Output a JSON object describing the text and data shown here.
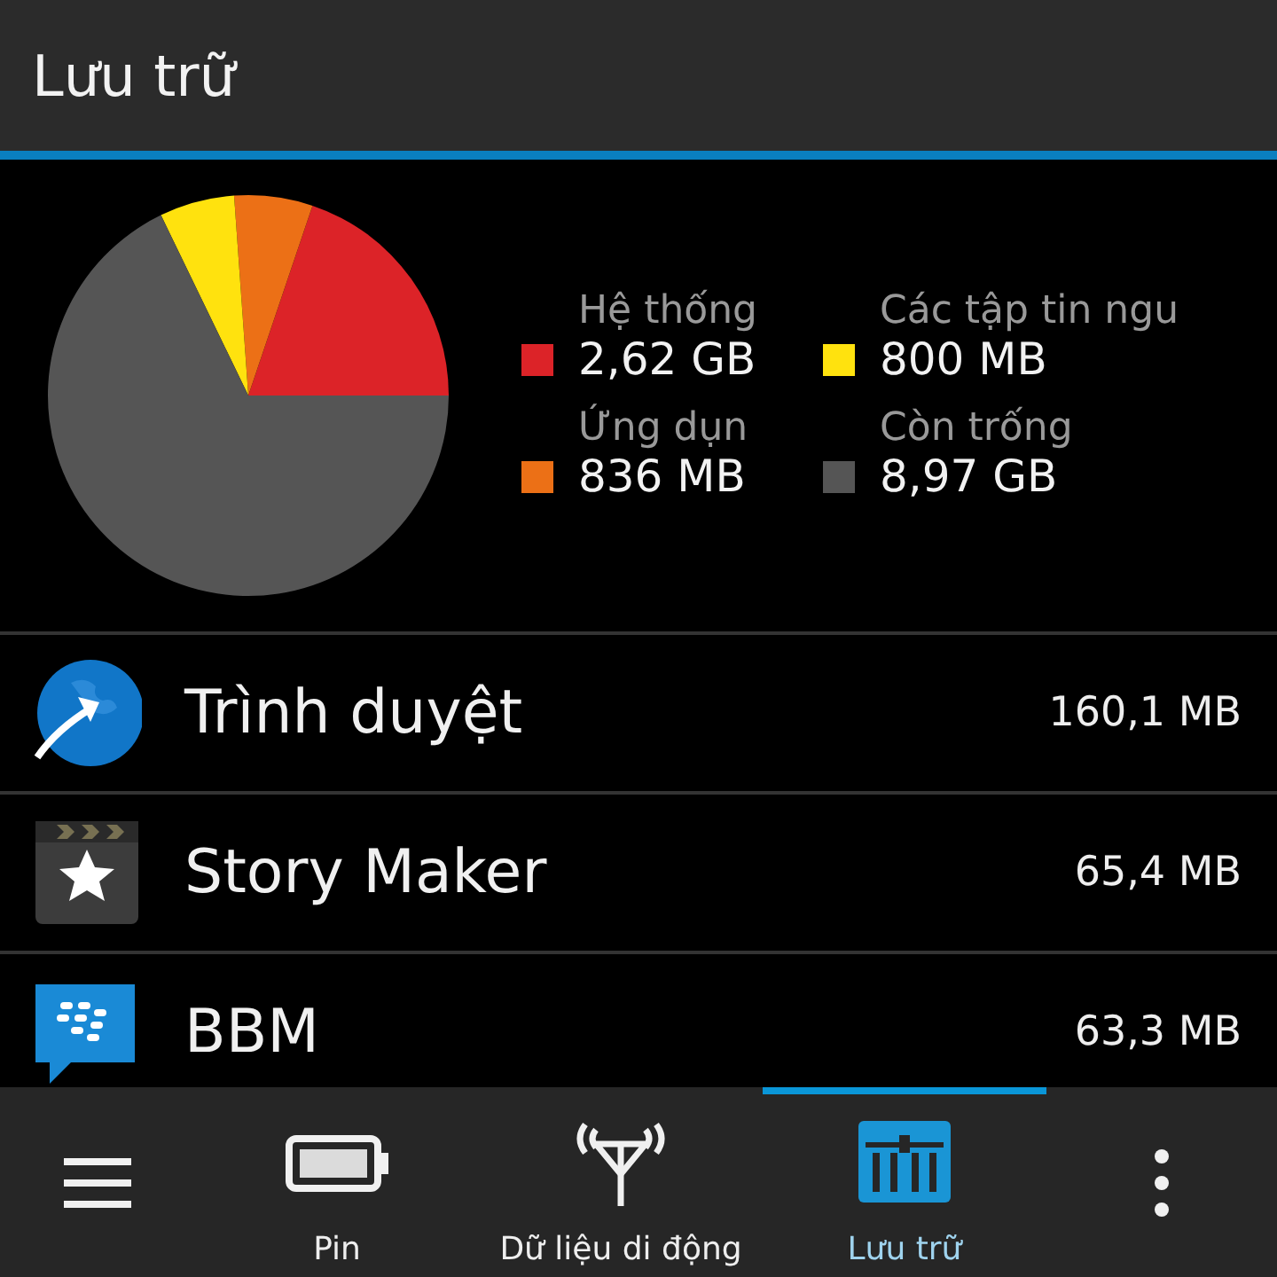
{
  "header": {
    "title": "Lưu trữ"
  },
  "storage": {
    "chart_data": {
      "type": "pie",
      "values": [
        19.81,
        6.32,
        6.05,
        67.82
      ],
      "colors": [
        "#dc2328",
        "#ec7016",
        "#ffe20e",
        "#555555"
      ]
    },
    "legend": [
      {
        "label": "Hệ thống",
        "amount": "2,62 GB",
        "color": "#dc2328"
      },
      {
        "label": "Các tập tin ngu",
        "amount": "800 MB",
        "color": "#ffe20e"
      },
      {
        "label": "Ứng dụn",
        "amount": "836 MB",
        "color": "#ec7016"
      },
      {
        "label": "Còn trống",
        "amount": "8,97 GB",
        "color": "#555555"
      }
    ]
  },
  "apps": [
    {
      "kind": "browser",
      "name": "Trình duyệt",
      "size": "160,1 MB"
    },
    {
      "kind": "story",
      "name": "Story Maker",
      "size": "65,4 MB"
    },
    {
      "kind": "chat",
      "name": "BBM",
      "size": "63,3 MB"
    }
  ],
  "tabs": [
    {
      "kind": "battery",
      "label": "Pin",
      "selected": false
    },
    {
      "kind": "antenna",
      "label": "Dữ liệu di động",
      "selected": false
    },
    {
      "kind": "storage",
      "label": "Lưu trữ",
      "selected": true
    }
  ]
}
